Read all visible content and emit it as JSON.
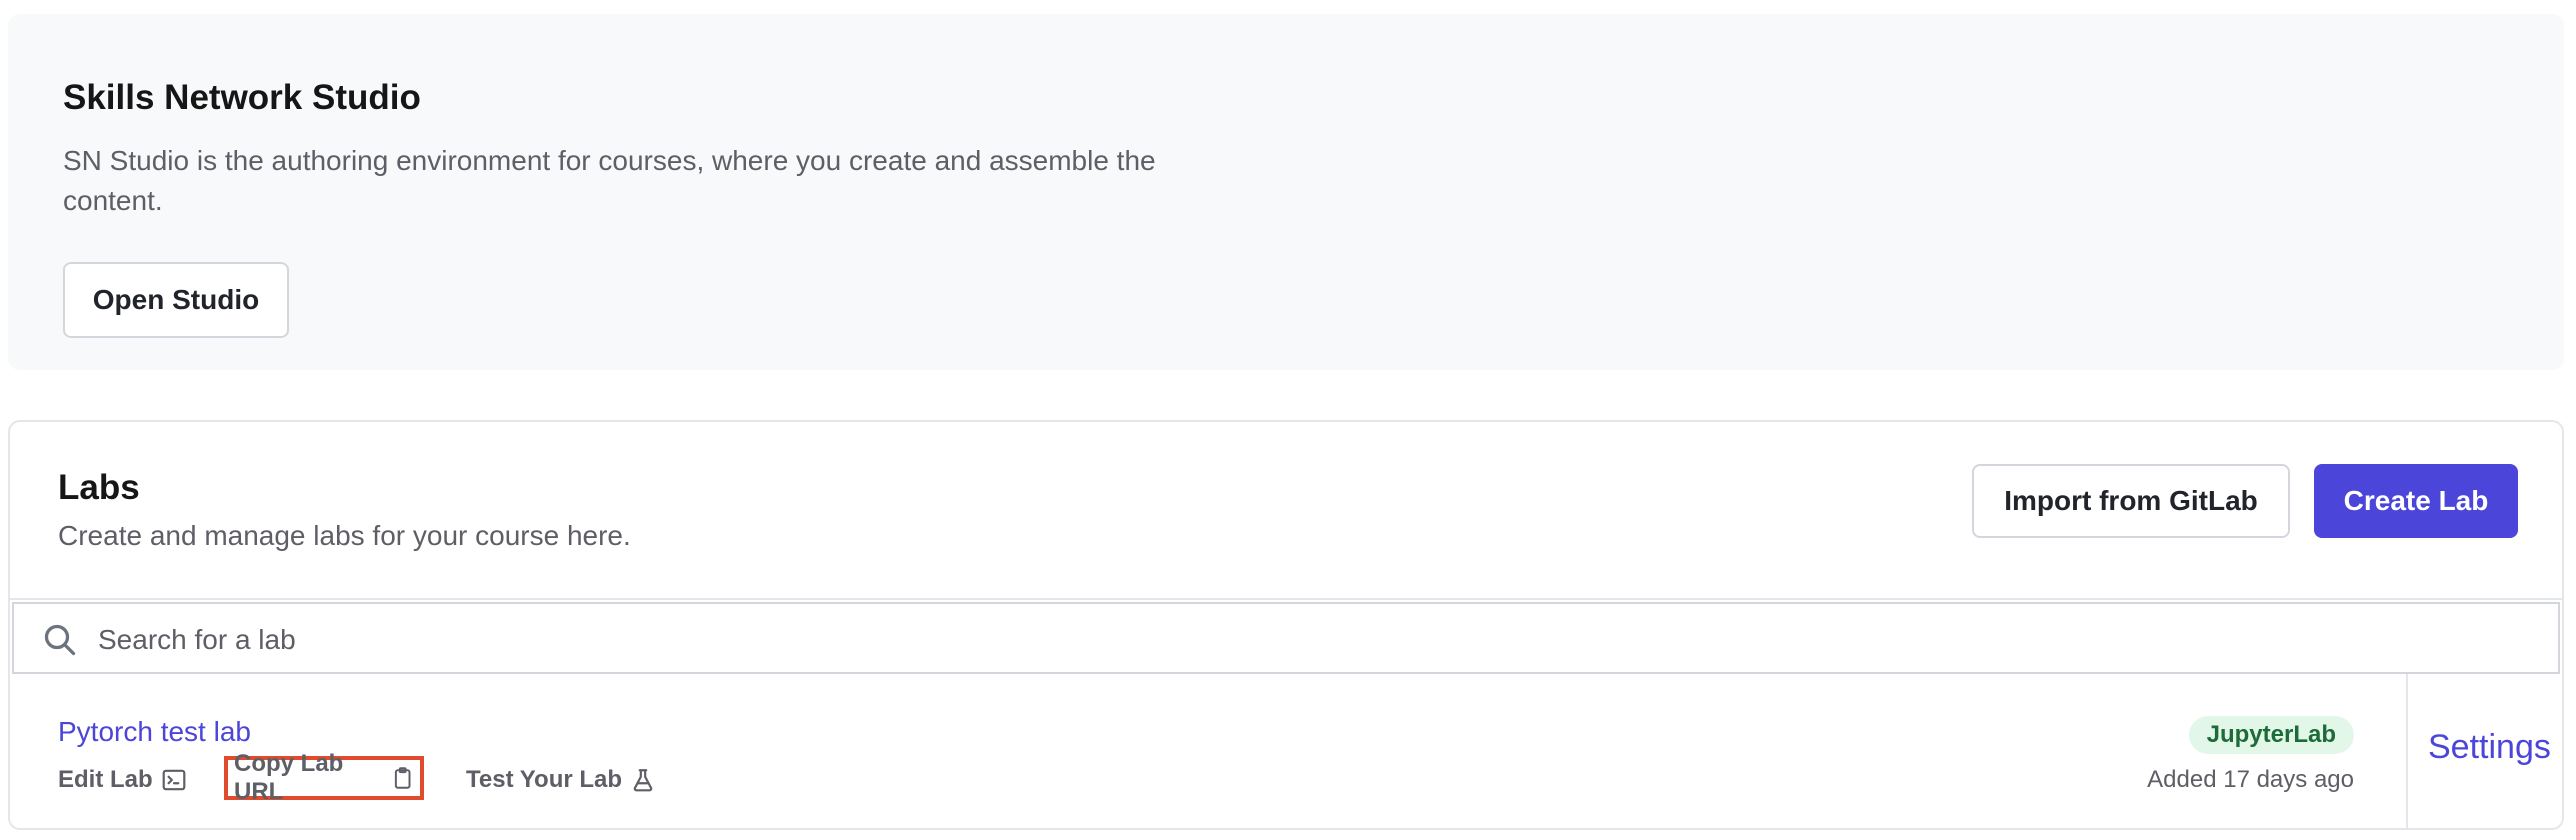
{
  "studio": {
    "title": "Skills Network Studio",
    "description": "SN Studio is the authoring environment for courses, where you create and assemble the content.",
    "open_button": "Open Studio"
  },
  "labs": {
    "title": "Labs",
    "description": "Create and manage labs for your course here.",
    "import_button": "Import from GitLab",
    "create_button": "Create Lab",
    "search": {
      "placeholder": "Search for a lab",
      "value": ""
    },
    "items": [
      {
        "name": "Pytorch test lab",
        "actions": {
          "edit": "Edit Lab",
          "copy_url": "Copy Lab URL",
          "test": "Test Your Lab"
        },
        "badge": "JupyterLab",
        "added": "Added 17 days ago",
        "settings": "Settings"
      }
    ]
  },
  "colors": {
    "accent": "#4b45d9",
    "badge_bg": "#e3f7e9",
    "badge_text": "#1c6b39",
    "highlight": "#e04a2d"
  },
  "icons": {
    "search": "search-icon",
    "edit": "terminal-icon",
    "copy": "clipboard-icon",
    "test": "flask-icon"
  }
}
